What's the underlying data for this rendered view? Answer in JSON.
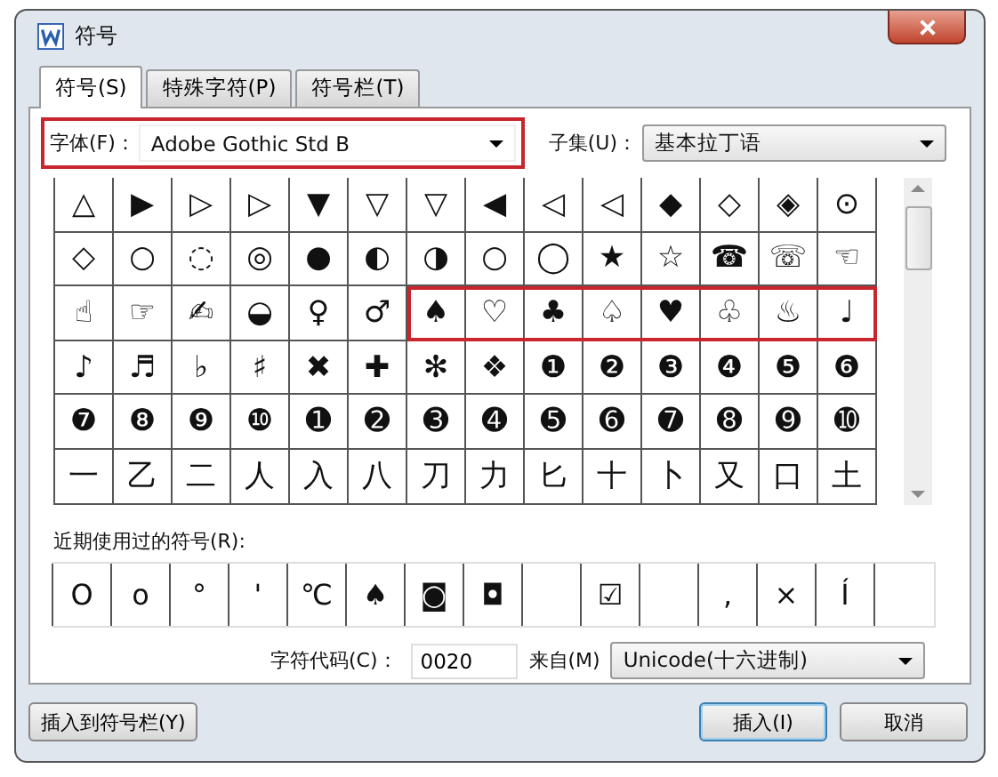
{
  "window": {
    "title": "符号"
  },
  "tabs": [
    {
      "label": "符号(S)",
      "selected": true
    },
    {
      "label": "特殊字符(P)",
      "selected": false
    },
    {
      "label": "符号栏(T)",
      "selected": false
    }
  ],
  "font": {
    "label": "字体(F)：",
    "value": "Adobe Gothic Std B",
    "highlighted": true
  },
  "subset": {
    "label": "子集(U)：",
    "value": "基本拉丁语"
  },
  "symbol_rows": [
    {
      "cells": [
        "△",
        "▶",
        "▷",
        "▷",
        "▼",
        "▽",
        "▽",
        "◀",
        "◁",
        "◁",
        "◆",
        "◇",
        "◈",
        "⊙"
      ],
      "marked_cells": []
    },
    {
      "cells": [
        "◇",
        "○",
        "◌",
        "◎",
        "●",
        "◐",
        "◑",
        "○",
        "◯",
        "★",
        "☆",
        "☎",
        "☏",
        "☜"
      ],
      "marked_cells": []
    },
    {
      "cells": [
        "☝",
        "☞",
        "✍",
        "◒",
        "♀",
        "♂"
      ],
      "marked_cells": [
        "♠",
        "♡",
        "♣",
        "♤",
        "♥",
        "♧",
        "♨",
        "♩"
      ]
    },
    {
      "cells": [
        "♪",
        "♬",
        "♭",
        "♯",
        "✖",
        "✚",
        "✻",
        "❖",
        "❶",
        "❷",
        "❸",
        "❹",
        "❺",
        "❻"
      ],
      "marked_cells": []
    },
    {
      "cells": [
        "❼",
        "❽",
        "❾",
        "❿",
        "➊",
        "➋",
        "➌",
        "➍",
        "➎",
        "➏",
        "➐",
        "➑",
        "➒",
        "➓"
      ],
      "marked_cells": []
    },
    {
      "cells": [
        "一",
        "乙",
        "二",
        "人",
        "入",
        "八",
        "刀",
        "力",
        "匕",
        "十",
        "卜",
        "又",
        "口",
        "土"
      ],
      "marked_cells": []
    }
  ],
  "recent": {
    "label": "近期使用过的符号(R):",
    "cells": [
      {
        "kind": "symbol",
        "char": "O"
      },
      {
        "kind": "symbol",
        "char": "o"
      },
      {
        "kind": "symbol",
        "char": "°"
      },
      {
        "kind": "symbol",
        "char": "'"
      },
      {
        "kind": "symbol",
        "char": "℃"
      },
      {
        "kind": "symbol",
        "char": "♠"
      },
      {
        "kind": "symbol",
        "char": "◙"
      },
      {
        "kind": "symbol",
        "char": "◘"
      },
      {
        "kind": "empty"
      },
      {
        "kind": "symbol",
        "char": "☑"
      },
      {
        "kind": "empty"
      },
      {
        "kind": "symbol",
        "char": ","
      },
      {
        "kind": "symbol",
        "char": "×"
      },
      {
        "kind": "symbol",
        "char": "Í"
      }
    ]
  },
  "char_code": {
    "label": "字符代码(C)：",
    "value": "0020"
  },
  "from": {
    "label": "来自(M)",
    "value": "Unicode(十六进制)"
  },
  "buttons": [
    {
      "label": "插入到符号栏(Y)",
      "default": false
    },
    {
      "label": "插入(I)",
      "default": true
    },
    {
      "label": "取消",
      "default": false
    }
  ]
}
